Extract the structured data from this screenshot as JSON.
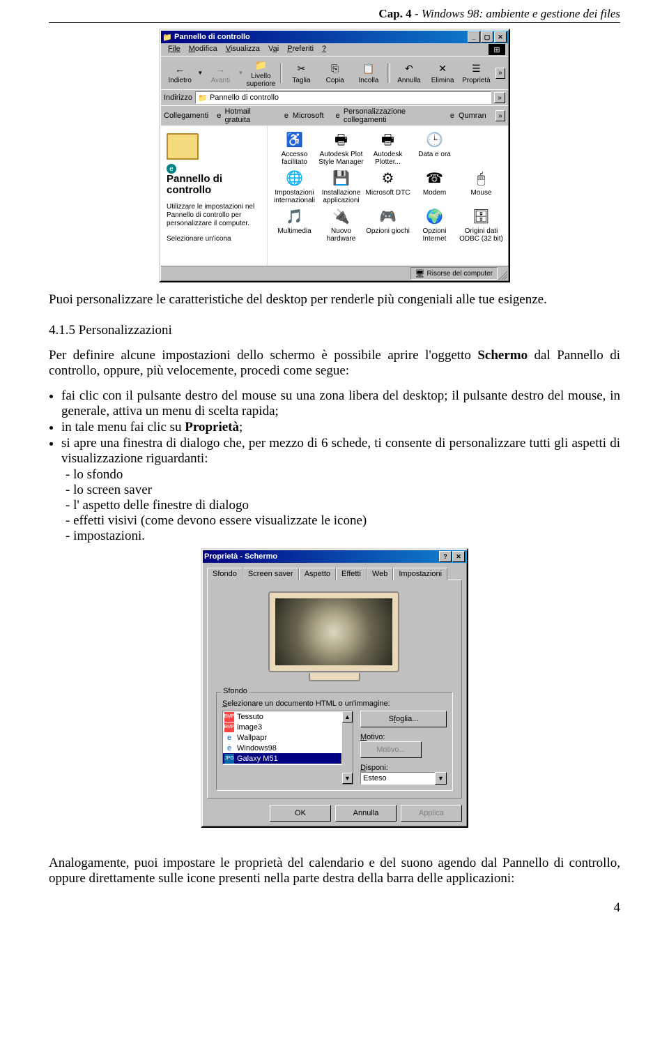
{
  "header": {
    "prefix": "Cap. 4",
    "rest": " -  Windows 98: ambiente e gestione dei files"
  },
  "page_number": "4",
  "text": {
    "intro": "Puoi personalizzare le caratteristiche del desktop per renderle più congeniali alle tue esigenze.",
    "sec_num": "4.1.5 Personalizzazioni",
    "p1a": "Per definire alcune impostazioni dello schermo è possibile aprire l'oggetto ",
    "p1b": " dal Pannello di controllo, oppure, più velocemente, procedi come segue:",
    "schermo": "Schermo",
    "b1": "fai clic con il pulsante destro del mouse su una zona libera del desktop; il pulsante destro del mouse, in generale, attiva un menu di scelta rapida;",
    "b2a": "in tale menu fai clic su ",
    "b2b": ";",
    "proprieta": "Proprietà",
    "b3": "si apre una finestra di dialogo che, per mezzo di 6 schede, ti consente di personalizzare tutti gli aspetti di visualizzazione riguardanti:",
    "d1": "lo sfondo",
    "d2": "lo screen saver",
    "d3": "l' aspetto delle finestre di dialogo",
    "d4": "effetti visivi (come devono essere visualizzate le icone)",
    "d5": "impostazioni.",
    "closing": "Analogamente, puoi impostare le proprietà del calendario e del suono agendo dal Pannello di controllo, oppure direttamente sulle icone presenti nella parte destra della barra delle applicazioni:"
  },
  "cp_window": {
    "title": "Pannello di controllo",
    "menu": [
      "File",
      "Modifica",
      "Visualizza",
      "Vai",
      "Preferiti",
      "?"
    ],
    "toolbar": [
      {
        "label": "Indietro",
        "glyph": "←",
        "dropdown": true
      },
      {
        "label": "Avanti",
        "glyph": "→",
        "dim": true,
        "dropdown": true
      },
      {
        "label": "Livello superiore",
        "glyph": "↥"
      },
      {
        "sep": true
      },
      {
        "label": "Taglia",
        "glyph": "✂"
      },
      {
        "label": "Copia",
        "glyph": "⎘"
      },
      {
        "label": "Incolla",
        "glyph": "📋"
      },
      {
        "sep": true
      },
      {
        "label": "Annulla",
        "glyph": "↶"
      },
      {
        "label": "Elimina",
        "glyph": "✕"
      },
      {
        "label": "Proprietà",
        "glyph": "☰"
      }
    ],
    "addr_label": "Indirizzo",
    "addr_value": "Pannello di controllo",
    "links_label": "Collegamenti",
    "links": [
      "Hotmail gratuita",
      "Microsoft",
      "Personalizzazione collegamenti",
      "Qumran"
    ],
    "left_title": "Pannello di controllo",
    "left_text1": "Utilizzare le impostazioni nel Pannello di controllo per personalizzare il computer.",
    "left_text2": "Selezionare un'icona",
    "icons": [
      {
        "label": "Accesso facilitato",
        "glyph": "♿"
      },
      {
        "label": "Autodesk Plot Style Manager",
        "glyph": "🖶"
      },
      {
        "label": "Autodesk Plotter...",
        "glyph": "🖶"
      },
      {
        "label": "Data e ora",
        "glyph": "🕒"
      },
      {
        "label": "",
        "glyph": ""
      },
      {
        "label": "Impostazioni internazionali",
        "glyph": "🌐"
      },
      {
        "label": "Installazione applicazioni",
        "glyph": "💾"
      },
      {
        "label": "Microsoft DTC",
        "glyph": "⚙"
      },
      {
        "label": "Modem",
        "glyph": "☎"
      },
      {
        "label": "Mouse",
        "glyph": "🖱"
      },
      {
        "label": "Multimedia",
        "glyph": "🎵"
      },
      {
        "label": "Nuovo hardware",
        "glyph": "🔌"
      },
      {
        "label": "Opzioni giochi",
        "glyph": "🎮"
      },
      {
        "label": "Opzioni Internet",
        "glyph": "🌍"
      },
      {
        "label": "Origini dati ODBC (32 bit)",
        "glyph": "🗄"
      }
    ],
    "status": "Risorse del computer"
  },
  "dialog": {
    "title": "Proprietà - Schermo",
    "tabs": [
      "Sfondo",
      "Screen saver",
      "Aspetto",
      "Effetti",
      "Web",
      "Impostazioni"
    ],
    "active_tab": "Sfondo",
    "group_title": "Sfondo",
    "group_sub": "Selezionare un documento HTML o un'immagine:",
    "wallpapers": [
      {
        "label": "Tessuto",
        "type": "bmp"
      },
      {
        "label": "image3",
        "type": "bmp"
      },
      {
        "label": "Wallpapr",
        "type": "html"
      },
      {
        "label": "Windows98",
        "type": "html"
      },
      {
        "label": "Galaxy M51",
        "type": "jpg",
        "selected": true
      }
    ],
    "sfoglia": "Sfoglia...",
    "motivo_label": "Motivo:",
    "motivo_btn": "Motivo...",
    "disponi_label": "Disponi:",
    "disponi_value": "Esteso",
    "ok": "OK",
    "annulla": "Annulla",
    "applica": "Applica"
  }
}
